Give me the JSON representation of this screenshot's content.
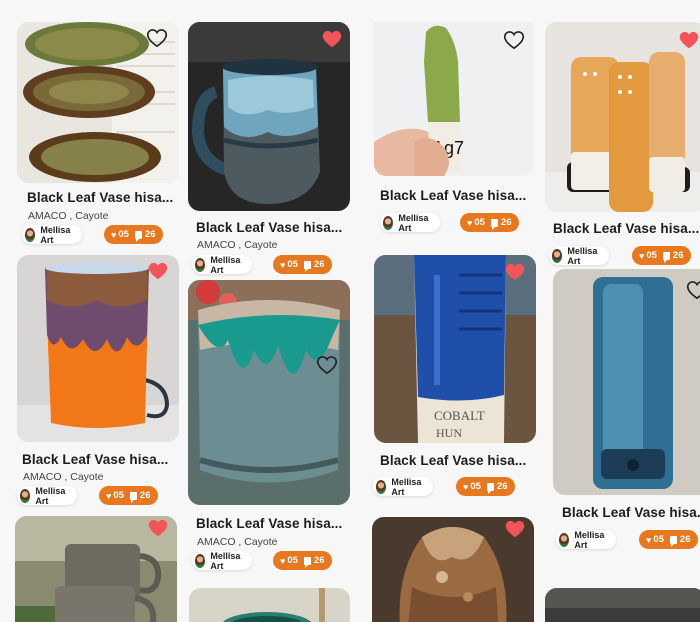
{
  "colors": {
    "accent": "#e8781f",
    "liked": "#f2545b",
    "background": "#f7f7f7"
  },
  "cards": [
    {
      "title": "Black Leaf Vase hisa...",
      "subtitle": "AMACO , Cayote",
      "author": "Mellisa Art",
      "likes": "05",
      "comments": "26",
      "liked": false,
      "image": "green-oval-plates"
    },
    {
      "title": "Black Leaf Vase hisa...",
      "subtitle": "AMACO , Cayote",
      "author": "Mellisa Art",
      "likes": "05",
      "comments": "26",
      "liked": true,
      "image": "blue-grey-mug"
    },
    {
      "title": "Black Leaf Vase hisa...",
      "subtitle": "",
      "author": "Mellisa Art",
      "likes": "05",
      "comments": "26",
      "liked": false,
      "image": "green-glazed-piece"
    },
    {
      "title": "Black Leaf Vase hisa...",
      "subtitle": "",
      "author": "Mellisa Art",
      "likes": "05",
      "comments": "26",
      "liked": true,
      "image": "orange-tiles"
    },
    {
      "title": "Black Leaf Vase hisa...",
      "subtitle": "AMACO , Cayote",
      "author": "Mellisa Art",
      "likes": "05",
      "comments": "26",
      "liked": true,
      "image": "orange-drip-tumbler"
    },
    {
      "title": "Black Leaf Vase hisa...",
      "subtitle": "AMACO , Cayote",
      "author": "Mellisa Art",
      "likes": "05",
      "comments": "26",
      "liked": false,
      "image": "teal-drip-bowl"
    },
    {
      "title": "Black Leaf Vase hisa...",
      "subtitle": "",
      "author": "Mellisa Art",
      "likes": "05",
      "comments": "26",
      "liked": true,
      "image": "cobalt-test-tile"
    },
    {
      "title": "Black Leaf Vase hisa...",
      "subtitle": "",
      "author": "Mellisa Art",
      "likes": "05",
      "comments": "26",
      "liked": false,
      "image": "blue-test-tile"
    },
    {
      "title": "",
      "subtitle": "",
      "author": "",
      "likes": "",
      "comments": "",
      "liked": true,
      "image": "stacked-grey-mugs"
    },
    {
      "title": "",
      "subtitle": "",
      "author": "",
      "likes": "",
      "comments": "",
      "liked": false,
      "image": "teal-vessel-partial"
    },
    {
      "title": "",
      "subtitle": "",
      "author": "",
      "likes": "",
      "comments": "",
      "liked": true,
      "image": "bronze-vase"
    },
    {
      "title": "",
      "subtitle": "",
      "author": "",
      "likes": "",
      "comments": "",
      "liked": false,
      "image": "dark-piece-partial"
    }
  ]
}
